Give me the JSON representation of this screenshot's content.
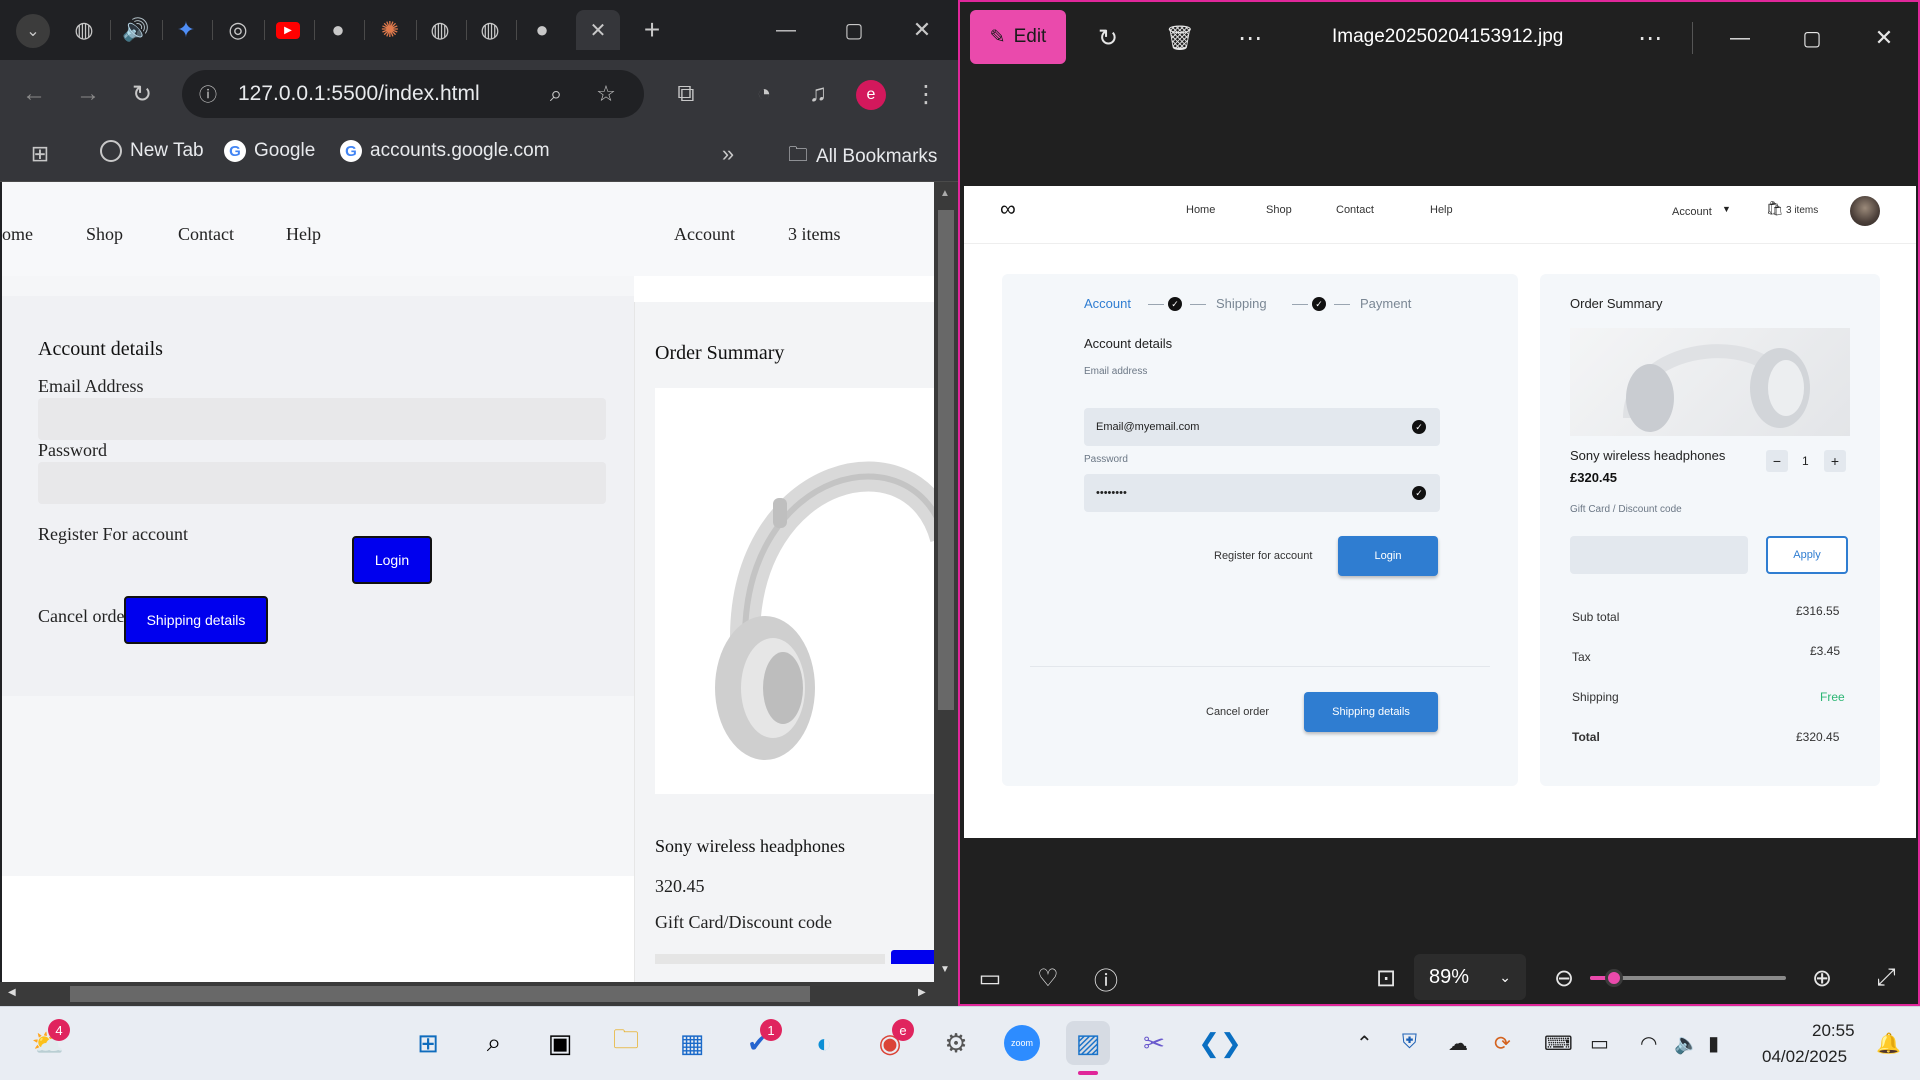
{
  "browser": {
    "url": "127.0.0.1:5500/index.html",
    "profile_initial": "e",
    "bookmarks": [
      {
        "label": "New Tab"
      },
      {
        "label": "Google"
      },
      {
        "label": "accounts.google.com"
      }
    ],
    "all_bookmarks_label": "All Bookmarks",
    "page": {
      "nav": {
        "home": "ome",
        "shop": "Shop",
        "contact": "Contact",
        "help": "Help",
        "account": "Account",
        "items": "3 items"
      },
      "account_title": "Account details",
      "email_label": "Email Address",
      "password_label": "Password",
      "register_label": "Register For account",
      "login_button": "Login",
      "cancel_label": "Cancel order",
      "shipping_button": "Shipping details",
      "summary_title": "Order Summary",
      "product_name": "Sony wireless headphones",
      "product_price": "320.45",
      "gift_label": "Gift Card/Discount code"
    }
  },
  "photos": {
    "edit_label": "Edit",
    "filename": "Image20250204153912.jpg",
    "zoom": "89%",
    "zoom_fraction": 0.12,
    "mockup": {
      "nav": {
        "home": "Home",
        "shop": "Shop",
        "contact": "Contact",
        "help": "Help",
        "account": "Account",
        "items": "3 items"
      },
      "steps": [
        "Account",
        "Shipping",
        "Payment"
      ],
      "account_title": "Account details",
      "email_label": "Email address",
      "email_value": "Email@myemail.com",
      "password_label": "Password",
      "password_value": "••••••••",
      "register_label": "Register for account",
      "login_button": "Login",
      "cancel_label": "Cancel order",
      "shipping_button": "Shipping details",
      "summary_title": "Order Summary",
      "product_name": "Sony wireless headphones",
      "product_price": "£320.45",
      "quantity": "1",
      "gift_label": "Gift Card / Discount code",
      "apply_button": "Apply",
      "subtotal_label": "Sub total",
      "subtotal_value": "£316.55",
      "tax_label": "Tax",
      "tax_value": "£3.45",
      "shipping_label": "Shipping",
      "shipping_value": "Free",
      "total_label": "Total",
      "total_value": "£320.45"
    }
  },
  "taskbar": {
    "weather_badge": "4",
    "todo_badge": "1",
    "chrome_badge": "e",
    "time": "20:55",
    "date": "04/02/2025"
  },
  "colors": {
    "accent_pink": "#ea4aac",
    "mock_blue": "#2f7dd1",
    "raw_blue": "#0000ee",
    "free_green": "#2bb673"
  }
}
